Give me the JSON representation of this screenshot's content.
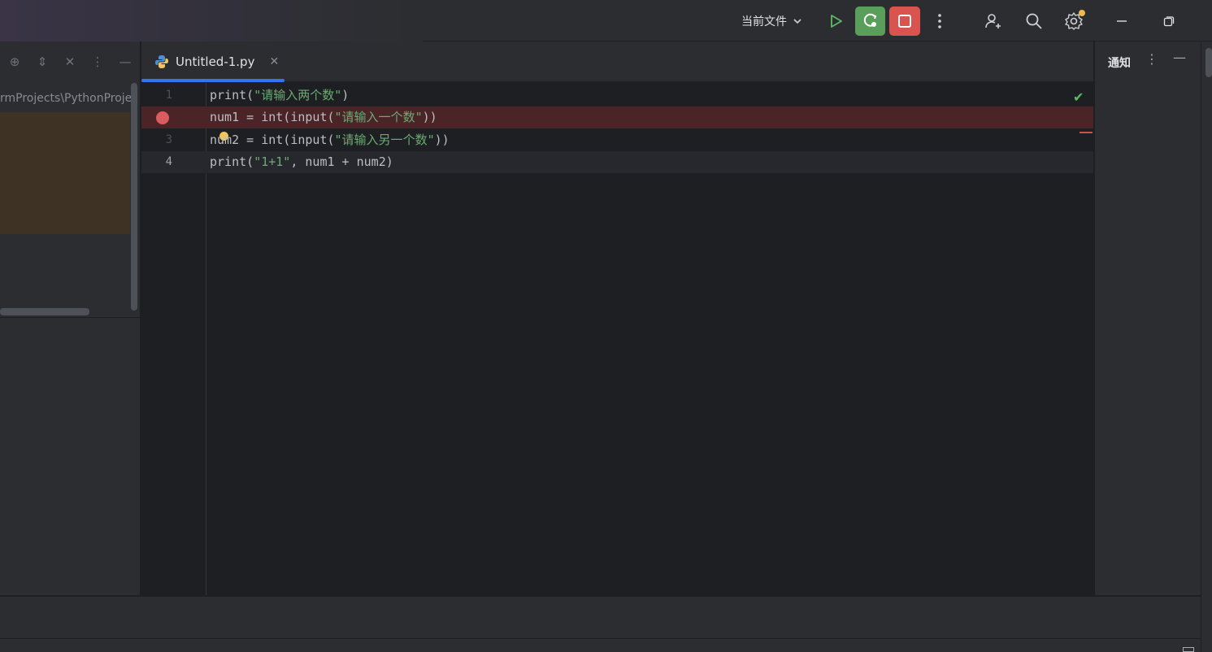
{
  "toolbar": {
    "run_config": "当前文件",
    "icons": [
      "chevron-down-icon",
      "run-icon",
      "debug-icon",
      "stop-icon",
      "more-icon",
      "add-user-icon",
      "search-icon",
      "settings-icon",
      "minimize-icon",
      "restore-icon"
    ]
  },
  "project_panel": {
    "path": "rmProjects\\PythonProje"
  },
  "editor": {
    "tab": {
      "label": "Untitled-1.py"
    },
    "lines": [
      {
        "num": "1",
        "parts": [
          {
            "t": "print(",
            "s": "p"
          },
          {
            "t": "\"请输入两个数\"",
            "s": "str"
          },
          {
            "t": ")",
            "s": "p"
          }
        ]
      },
      {
        "num": "",
        "parts": [
          {
            "t": "num1 = int(input(",
            "s": "p"
          },
          {
            "t": "\"请输入一个数\"",
            "s": "str"
          },
          {
            "t": "))",
            "s": "p"
          }
        ]
      },
      {
        "num": "3",
        "parts": [
          {
            "t": "num2 = int(input(",
            "s": "p"
          },
          {
            "t": "\"请输入另一个数\"",
            "s": "str"
          },
          {
            "t": "))",
            "s": "p"
          }
        ]
      },
      {
        "num": "4",
        "parts": [
          {
            "t": "print(",
            "s": "p"
          },
          {
            "t": "\"1+1\"",
            "s": "str"
          },
          {
            "t": ", num1 + num2)",
            "s": "p"
          }
        ]
      }
    ]
  },
  "notifications": {
    "title": "通知"
  },
  "colors": {
    "accent": "#3574f0",
    "breakpoint": "#db5c5c",
    "debug_button": "#5a9e5c",
    "stop_button": "#d9534f",
    "string": "#6aab73"
  }
}
